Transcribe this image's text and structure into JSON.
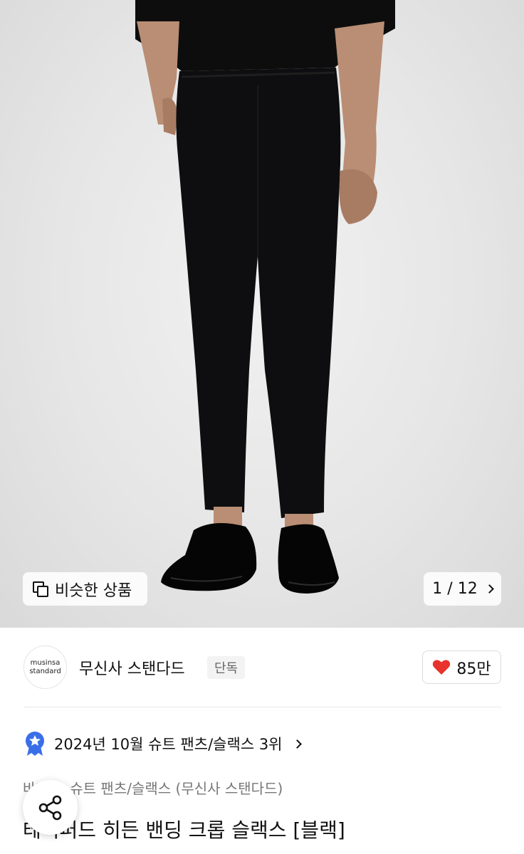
{
  "hero": {
    "similar_label": "비슷한 상품",
    "pager_current": "1",
    "pager_separator": "/",
    "pager_total": "12"
  },
  "brand": {
    "logo_line1": "musinsa",
    "logo_line2": "standard",
    "name": "무신사 스탠다드",
    "badge": "단독",
    "like_count": "85만"
  },
  "ranking": {
    "text": "2024년 10월 슈트 팬츠/슬랙스 3위"
  },
  "product": {
    "breadcrumb": "바지 > 슈트 팬츠/슬랙스 (무신사 스탠다드)",
    "title": "테이퍼드 히든 밴딩 크롭 슬랙스 [블랙]"
  },
  "colors": {
    "heart": "#e8322c",
    "rank_badge": "#3a6ee8"
  },
  "icons": [
    "similar-products-icon",
    "chevron-right-icon",
    "heart-icon",
    "ranking-badge-icon",
    "share-icon"
  ]
}
